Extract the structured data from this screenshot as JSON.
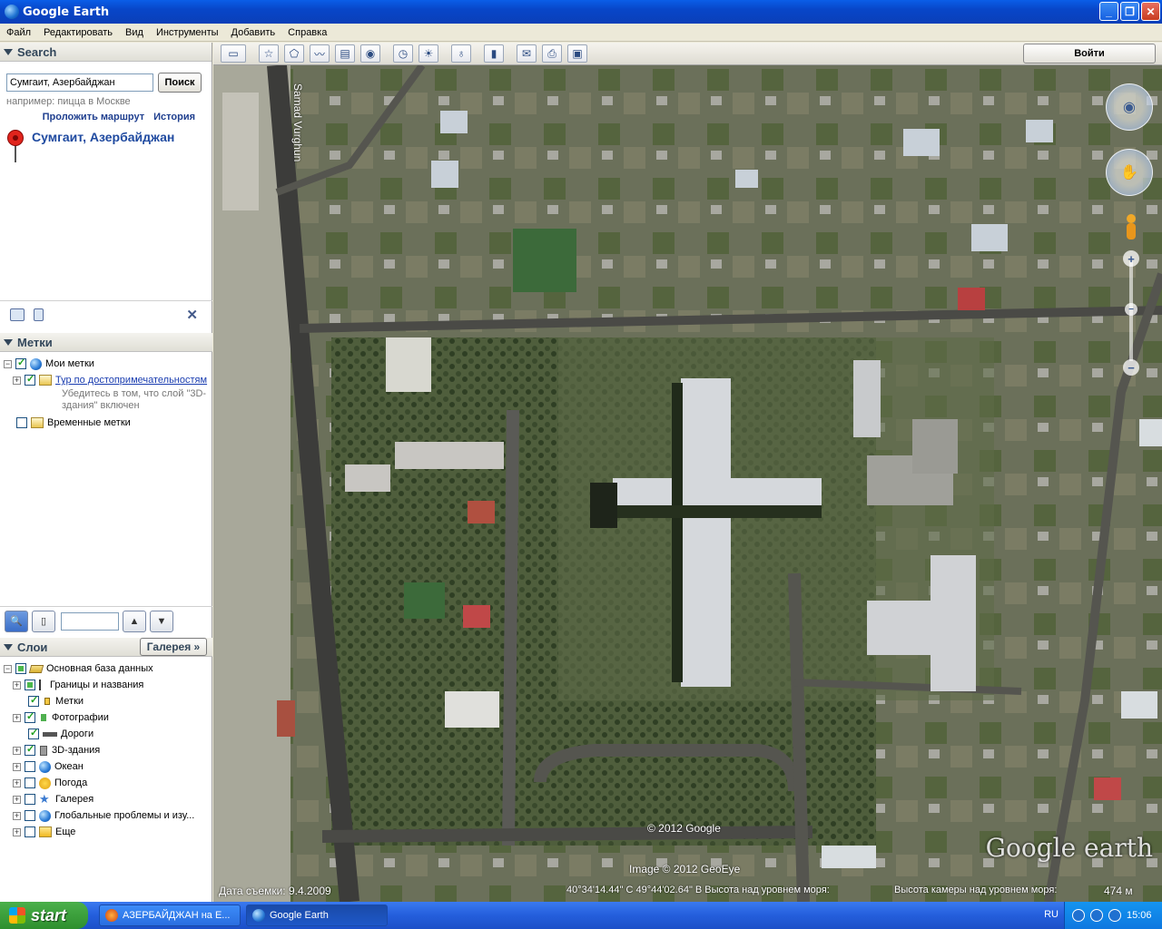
{
  "window": {
    "title": "Google Earth",
    "controls": [
      "_",
      "❐",
      "✕"
    ]
  },
  "menu": [
    "Файл",
    "Редактировать",
    "Вид",
    "Инструменты",
    "Добавить",
    "Справка"
  ],
  "search": {
    "header": "Search",
    "query": "Сумгаит, Азербайджан",
    "button": "Поиск",
    "hint": "например: пицца в Москве",
    "route_link": "Проложить маршрут",
    "history_link": "История",
    "result": "Сумгаит, Азербайджан"
  },
  "places": {
    "header": "Метки",
    "my_places": "Мои метки",
    "tour": "Тур по достопримечательностям",
    "tour_note_1": "Убедитесь в том, что слой \"3D-",
    "tour_note_2": "здания\" включен",
    "temp": "Временные метки"
  },
  "layers": {
    "header": "Слои",
    "gallery_button": "Галерея »",
    "items": [
      "Основная база данных",
      "Границы и названия",
      "Метки",
      "Фотографии",
      "Дороги",
      "3D-здания",
      "Океан",
      "Погода",
      "Галерея",
      "Глобальные проблемы и изу...",
      "Еще"
    ]
  },
  "toolbar": {
    "login": "Войти"
  },
  "map": {
    "street_label": "Samad Vurghun",
    "copyright_google": "© 2012 Google",
    "copyright_geoeye": "Image © 2012 GeoEye",
    "logo": "Google earth",
    "status_date": "Дата съемки: 9.4.2009",
    "status_coords": "40°34'14.44\" С  49°44'02.64\" В Высота над уровнем моря:",
    "status_eye": "Высота камеры над уровнем моря:",
    "status_alt": "474 м"
  },
  "taskbar": {
    "start": "start",
    "tasks": [
      "АЗЕРБАЙДЖАН на Е...",
      "Google Earth"
    ],
    "lang": "RU",
    "time": "15:06"
  }
}
